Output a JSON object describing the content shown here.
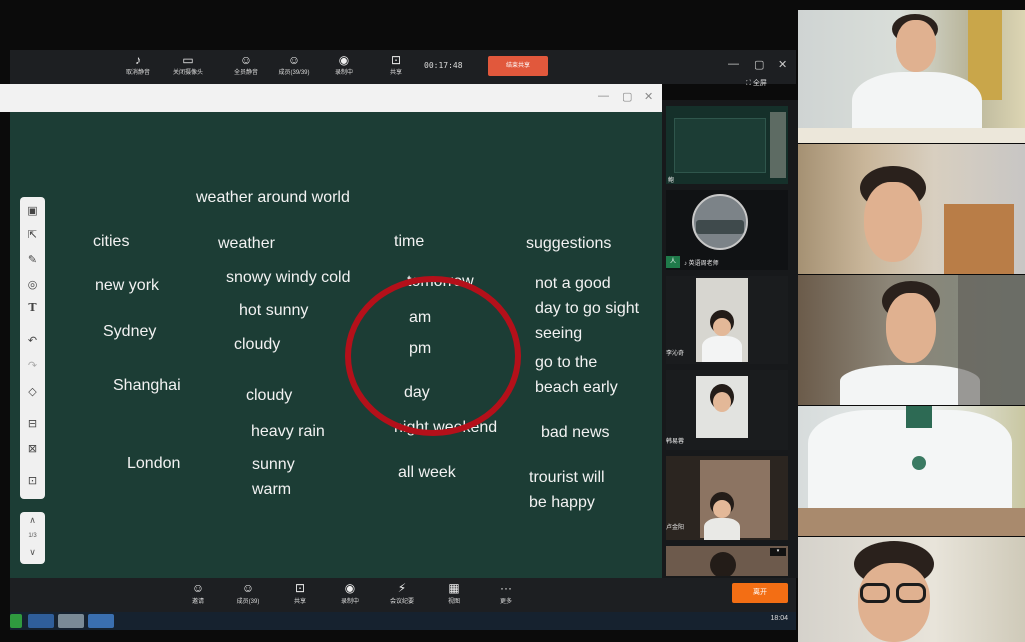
{
  "meeting": {
    "toolbar": {
      "items": [
        {
          "label": "取消静音",
          "icon": "mic-icon"
        },
        {
          "label": "关闭摄像头",
          "icon": "camera-icon"
        },
        {
          "label": "全员静音",
          "icon": "mute-all-icon"
        },
        {
          "label": "成员(39/39)",
          "icon": "members-icon"
        },
        {
          "label": "录制中",
          "icon": "record-icon"
        },
        {
          "label": "共享",
          "icon": "share-icon"
        }
      ],
      "timer": "00:17:48",
      "stop_share_label": "结束共享",
      "fullscreen_label": "全屏"
    },
    "bottom_toolbar": {
      "items": [
        {
          "label": "邀请",
          "icon": "invite-icon"
        },
        {
          "label": "成员(39)",
          "icon": "members-icon"
        },
        {
          "label": "共享",
          "icon": "share-icon"
        },
        {
          "label": "录制中",
          "icon": "record-icon"
        },
        {
          "label": "会议纪要",
          "icon": "notes-icon"
        },
        {
          "label": "视图",
          "icon": "view-icon"
        },
        {
          "label": "更多",
          "icon": "more-icon"
        }
      ],
      "leave_label": "离开"
    },
    "participants": {
      "speaker_label": "英语周老师",
      "names": [
        "鲍",
        "李沁奇",
        "韩易蓉",
        "卢金阳"
      ]
    }
  },
  "whiteboard": {
    "title": "weather around world",
    "columns": [
      {
        "header": "cities",
        "items": [
          "new york",
          "Sydney",
          "Shanghai",
          "London"
        ]
      },
      {
        "header": "weather",
        "items": [
          "snowy windy cold",
          "hot sunny",
          "cloudy",
          "cloudy",
          "heavy rain",
          "sunny",
          "warm"
        ]
      },
      {
        "header": "time",
        "items": [
          "tomorrow",
          "am",
          "pm",
          "day",
          "night weekend",
          "all week"
        ]
      },
      {
        "header": "suggestions",
        "items": [
          "not a good",
          "day to go sight",
          "seeing",
          "go to the",
          "beach early",
          "bad news",
          "trourist will",
          "be happy"
        ]
      }
    ],
    "page_indicator": "1/3"
  },
  "taskbar": {
    "clock": "18:04"
  },
  "colors": {
    "board": "#1c3d35",
    "circle": "#b4101a",
    "stop_share": "#e1583c",
    "leave": "#f36e14"
  }
}
